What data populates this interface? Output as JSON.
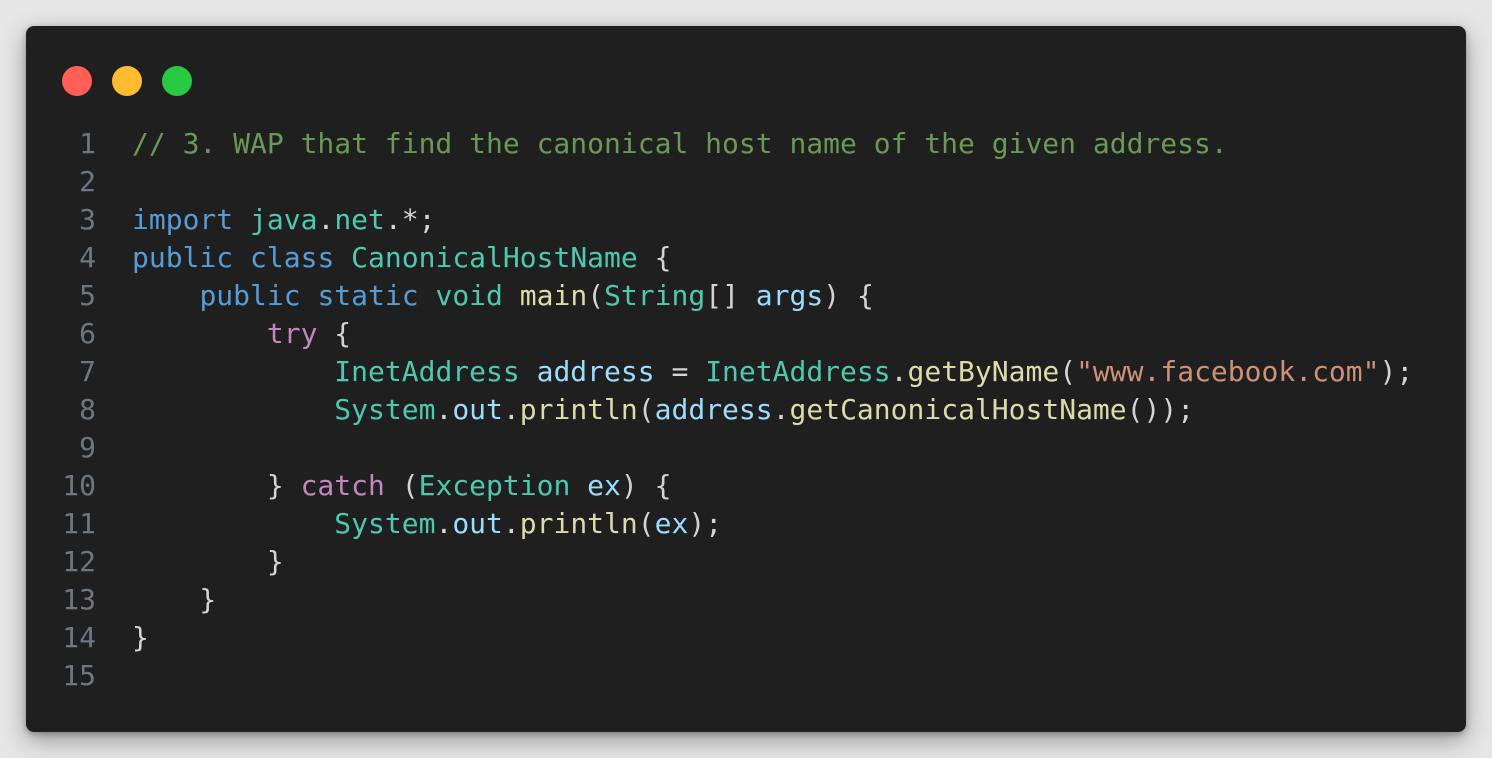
{
  "window": {
    "colors": {
      "background": "#1f1f1f",
      "close": "#ff5f57",
      "minimize": "#febc2e",
      "maximize": "#28c840"
    }
  },
  "editor": {
    "language": "java",
    "theme_colors": {
      "comment": "#6a9955",
      "keyword": "#569cd6",
      "control": "#c586c0",
      "type": "#4ec9b0",
      "function": "#dcdcaa",
      "variable": "#9cdcfe",
      "string": "#ce9178",
      "punctuation": "#d4d4d4",
      "line_number": "#6e7681"
    },
    "lines": [
      {
        "n": "1",
        "tokens": [
          {
            "t": "// 3. WAP that find the canonical host name of the given address.",
            "c": "comment"
          }
        ]
      },
      {
        "n": "2",
        "tokens": []
      },
      {
        "n": "3",
        "tokens": [
          {
            "t": "import",
            "c": "kw"
          },
          {
            "t": " ",
            "c": "punc"
          },
          {
            "t": "java",
            "c": "type"
          },
          {
            "t": ".",
            "c": "punc"
          },
          {
            "t": "net",
            "c": "type"
          },
          {
            "t": ".*;",
            "c": "punc"
          }
        ]
      },
      {
        "n": "4",
        "tokens": [
          {
            "t": "public",
            "c": "kw"
          },
          {
            "t": " ",
            "c": "punc"
          },
          {
            "t": "class",
            "c": "kw"
          },
          {
            "t": " ",
            "c": "punc"
          },
          {
            "t": "CanonicalHostName",
            "c": "type"
          },
          {
            "t": " {",
            "c": "punc"
          }
        ]
      },
      {
        "n": "5",
        "tokens": [
          {
            "t": "    ",
            "c": "punc"
          },
          {
            "t": "public",
            "c": "kw"
          },
          {
            "t": " ",
            "c": "punc"
          },
          {
            "t": "static",
            "c": "kw"
          },
          {
            "t": " ",
            "c": "punc"
          },
          {
            "t": "void",
            "c": "type"
          },
          {
            "t": " ",
            "c": "punc"
          },
          {
            "t": "main",
            "c": "fn"
          },
          {
            "t": "(",
            "c": "punc"
          },
          {
            "t": "String",
            "c": "type"
          },
          {
            "t": "[] ",
            "c": "punc"
          },
          {
            "t": "args",
            "c": "var"
          },
          {
            "t": ") {",
            "c": "punc"
          }
        ]
      },
      {
        "n": "6",
        "tokens": [
          {
            "t": "        ",
            "c": "punc"
          },
          {
            "t": "try",
            "c": "ctrl"
          },
          {
            "t": " {",
            "c": "punc"
          }
        ]
      },
      {
        "n": "7",
        "tokens": [
          {
            "t": "            ",
            "c": "punc"
          },
          {
            "t": "InetAddress",
            "c": "type"
          },
          {
            "t": " ",
            "c": "punc"
          },
          {
            "t": "address",
            "c": "var"
          },
          {
            "t": " = ",
            "c": "punc"
          },
          {
            "t": "InetAddress",
            "c": "type"
          },
          {
            "t": ".",
            "c": "punc"
          },
          {
            "t": "getByName",
            "c": "fn"
          },
          {
            "t": "(",
            "c": "punc"
          },
          {
            "t": "\"www.facebook.com\"",
            "c": "str"
          },
          {
            "t": ");",
            "c": "punc"
          }
        ]
      },
      {
        "n": "8",
        "tokens": [
          {
            "t": "            ",
            "c": "punc"
          },
          {
            "t": "System",
            "c": "type"
          },
          {
            "t": ".",
            "c": "punc"
          },
          {
            "t": "out",
            "c": "var"
          },
          {
            "t": ".",
            "c": "punc"
          },
          {
            "t": "println",
            "c": "fn"
          },
          {
            "t": "(",
            "c": "punc"
          },
          {
            "t": "address",
            "c": "var"
          },
          {
            "t": ".",
            "c": "punc"
          },
          {
            "t": "getCanonicalHostName",
            "c": "fn"
          },
          {
            "t": "());",
            "c": "punc"
          }
        ]
      },
      {
        "n": "9",
        "tokens": []
      },
      {
        "n": "10",
        "tokens": [
          {
            "t": "        } ",
            "c": "punc"
          },
          {
            "t": "catch",
            "c": "ctrl"
          },
          {
            "t": " (",
            "c": "punc"
          },
          {
            "t": "Exception",
            "c": "type"
          },
          {
            "t": " ",
            "c": "punc"
          },
          {
            "t": "ex",
            "c": "var"
          },
          {
            "t": ") {",
            "c": "punc"
          }
        ]
      },
      {
        "n": "11",
        "tokens": [
          {
            "t": "            ",
            "c": "punc"
          },
          {
            "t": "System",
            "c": "type"
          },
          {
            "t": ".",
            "c": "punc"
          },
          {
            "t": "out",
            "c": "var"
          },
          {
            "t": ".",
            "c": "punc"
          },
          {
            "t": "println",
            "c": "fn"
          },
          {
            "t": "(",
            "c": "punc"
          },
          {
            "t": "ex",
            "c": "var"
          },
          {
            "t": ");",
            "c": "punc"
          }
        ]
      },
      {
        "n": "12",
        "tokens": [
          {
            "t": "        }",
            "c": "punc"
          }
        ]
      },
      {
        "n": "13",
        "tokens": [
          {
            "t": "    }",
            "c": "punc"
          }
        ]
      },
      {
        "n": "14",
        "tokens": [
          {
            "t": "}",
            "c": "punc"
          }
        ]
      },
      {
        "n": "15",
        "tokens": []
      }
    ]
  }
}
